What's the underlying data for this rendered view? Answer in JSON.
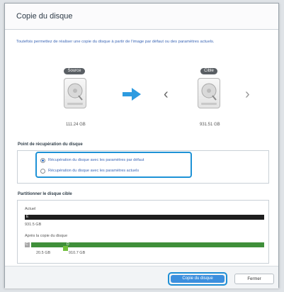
{
  "window": {
    "title": "Copie du disque"
  },
  "description": "Toutefois permettez de réaliser une copie du disque à partir de l'image par défaut ou des paramètres actuels.",
  "source": {
    "badge": "Source",
    "size": "111.24 GB"
  },
  "target": {
    "badge": "Cible",
    "size": "931.51 GB"
  },
  "icons": {
    "arrow": "arrow-right-icon",
    "prev": "chevron-left-icon",
    "next": "chevron-right-icon",
    "disk": "hard-disk-icon"
  },
  "recovery": {
    "title": "Point de récupération du disque",
    "options": [
      {
        "label": "Récupération du disque avec les paramètres par défaut",
        "selected": true
      },
      {
        "label": "Récupération du disque avec les paramètres actuels",
        "selected": false
      }
    ]
  },
  "partition": {
    "title": "Partitionner le disque cible",
    "current_label": "Actuel",
    "current_marker": "E",
    "current_size": "931.5 GB",
    "after_label": "Après la copie du disque",
    "after_markers": [
      "C",
      "D"
    ],
    "after_sizes": [
      "20.5 GB",
      "910.7 GB"
    ]
  },
  "colors": {
    "accent": "#1e92d6",
    "primary_button": "#3c8fde",
    "partition_dark": "#1e1e1e",
    "partition_green": "#3f8f3a",
    "partition_gray": "#a6a6a6"
  },
  "buttons": {
    "primary": "Copie du disque",
    "cancel": "Fermer"
  }
}
